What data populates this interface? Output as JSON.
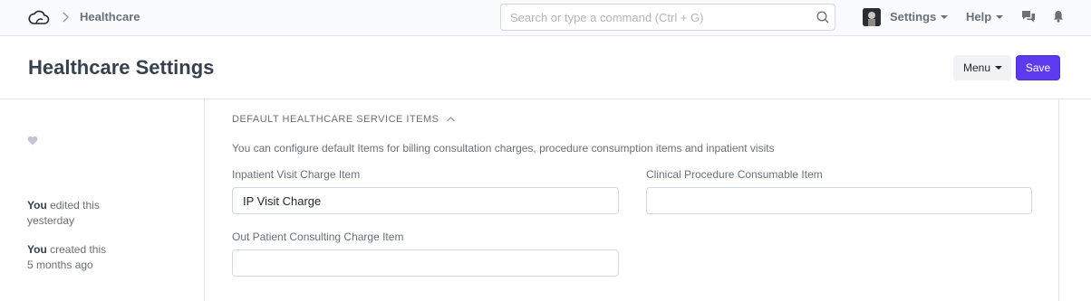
{
  "navbar": {
    "breadcrumb": "Healthcare",
    "search_placeholder": "Search or type a command (Ctrl + G)",
    "settings_label": "Settings",
    "help_label": "Help"
  },
  "page": {
    "title": "Healthcare Settings",
    "menu_label": "Menu",
    "save_label": "Save"
  },
  "sidebar": {
    "timeline": [
      {
        "who": "You",
        "action": " edited this",
        "when": "yesterday"
      },
      {
        "who": "You",
        "action": " created this",
        "when": "5 months ago"
      }
    ]
  },
  "section": {
    "title": "DEFAULT HEALTHCARE SERVICE ITEMS",
    "description": "You can configure default Items for billing consultation charges, procedure consumption items and inpatient visits",
    "fields": [
      {
        "label": "Inpatient Visit Charge Item",
        "value": "IP Visit Charge"
      },
      {
        "label": "Clinical Procedure Consumable Item",
        "value": ""
      },
      {
        "label": "Out Patient Consulting Charge Item",
        "value": ""
      }
    ]
  },
  "colors": {
    "primary": "#5e3aee",
    "text": "#1f272e",
    "muted": "#687178",
    "border": "#d1d8dd"
  }
}
